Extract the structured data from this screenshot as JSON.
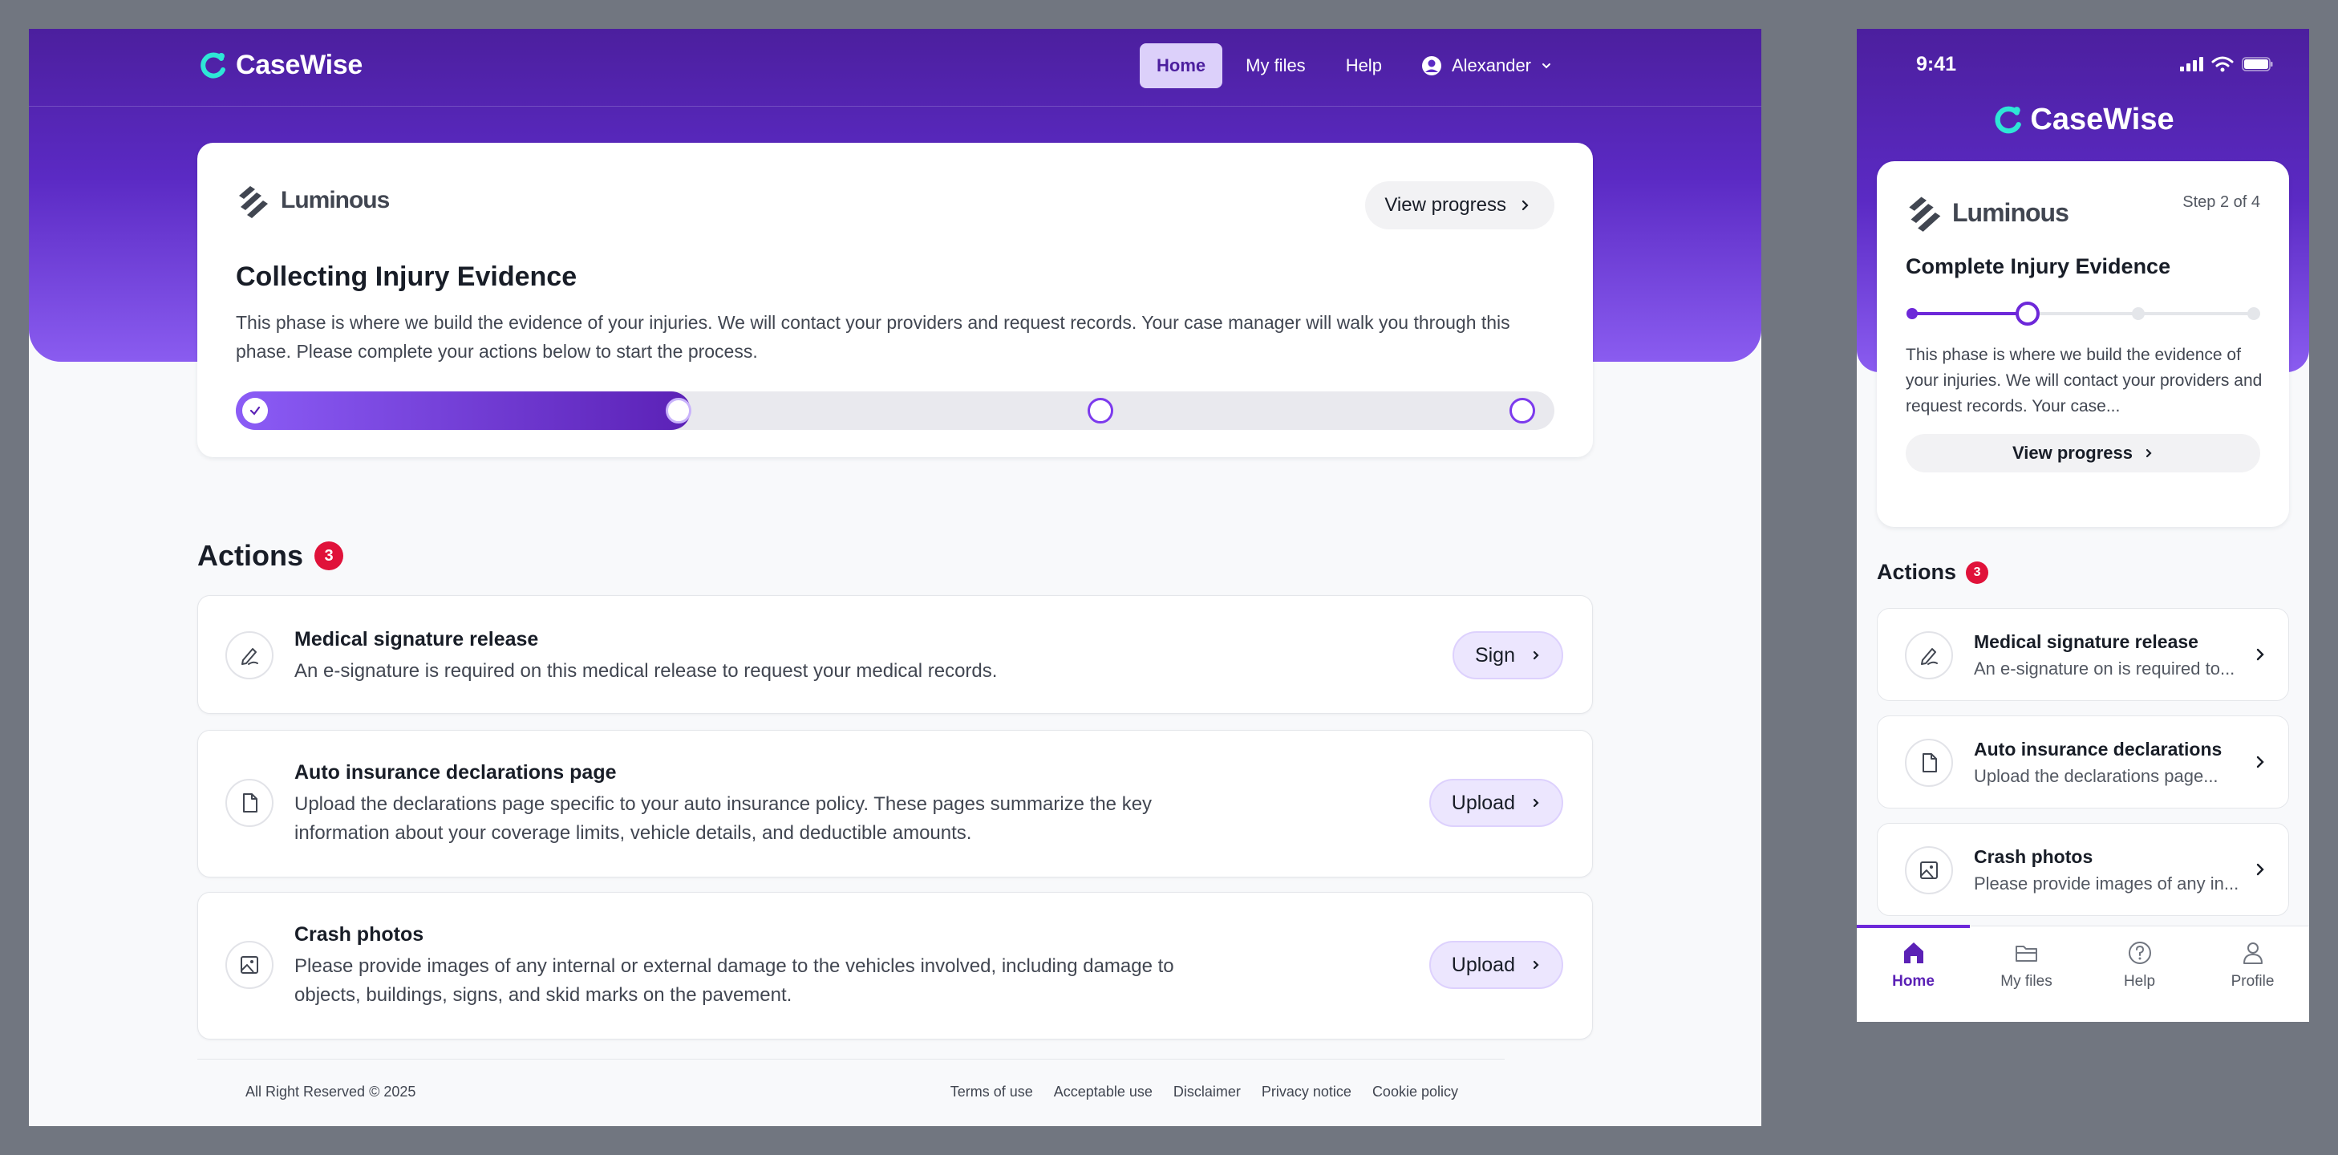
{
  "colors": {
    "brand_primary": "#5b2ac4",
    "brand_dark": "#4c1f9e",
    "accent_cyan": "#2ee6d6",
    "badge_red": "#e0123a",
    "button_tint": "#ece6fe"
  },
  "desktop": {
    "brand": "CaseWise",
    "nav": {
      "home": "Home",
      "files": "My files",
      "help": "Help",
      "user": "Alexander"
    },
    "phase": {
      "partner": "Luminous",
      "view_progress": "View progress",
      "title": "Collecting Injury Evidence",
      "description": "This phase is where we build the evidence of your injuries. We will contact your providers and request records. Your case manager will walk you through this phase. Please complete your actions below to start the process.",
      "progress_fraction": 0.345
    },
    "actions": {
      "title": "Actions",
      "count": "3",
      "items": [
        {
          "title": "Medical signature release",
          "desc": "An e-signature is required on this medical release to request your medical records.",
          "button": "Sign",
          "icon": "pen-icon"
        },
        {
          "title": "Auto insurance declarations page",
          "desc": "Upload the declarations page specific to your auto insurance policy. These pages  summarize the key information about your coverage limits, vehicle details, and deductible amounts.",
          "button": "Upload",
          "icon": "document-icon"
        },
        {
          "title": "Crash photos",
          "desc": "Please provide images of any internal or external damage to the vehicles involved, including damage to objects, buildings, signs, and skid marks on the pavement.",
          "button": "Upload",
          "icon": "image-icon"
        }
      ]
    },
    "footer": {
      "copyright": "All Right Reserved © 2025",
      "links": [
        "Terms of use",
        "Acceptable use",
        "Disclaimer",
        "Privacy notice",
        "Cookie policy"
      ]
    }
  },
  "mobile": {
    "time": "9:41",
    "brand": "CaseWise",
    "partner": "Luminous",
    "step": "Step 2 of 4",
    "title": "Complete Injury Evidence",
    "description": "This phase is where we build the evidence of your injuries. We will contact your providers and request records. Your case...",
    "view_progress": "View progress",
    "actions_title": "Actions",
    "actions_count": "3",
    "items": [
      {
        "title": "Medical signature release",
        "desc": "An e-signature on is required to..."
      },
      {
        "title": "Auto insurance declarations",
        "desc": "Upload the declarations page..."
      },
      {
        "title": "Crash photos",
        "desc": "Please provide images of any in..."
      }
    ],
    "tabs": [
      "Home",
      "My files",
      "Help",
      "Profile"
    ]
  }
}
